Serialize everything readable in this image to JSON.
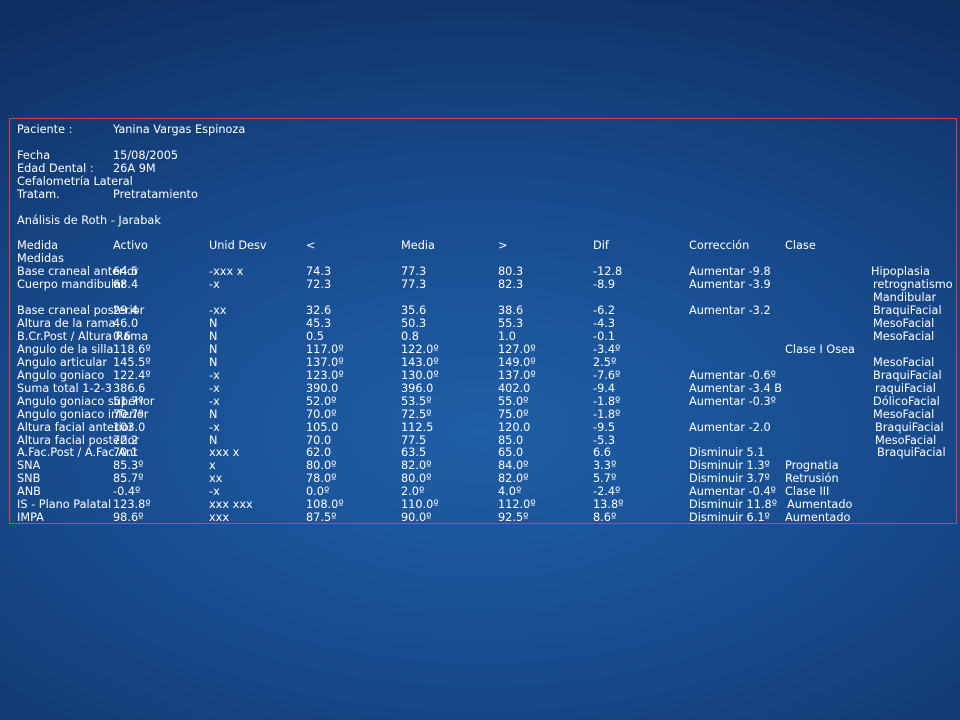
{
  "patient": {
    "patient_label": "Paciente :",
    "patient_value": "Yanina Vargas Espinoza",
    "date_label": "Fecha",
    "date_value": "15/08/2005",
    "age_label": "Edad Dental :",
    "age_value": "26A 9M",
    "study": "Cefalometría Lateral",
    "treatment_label": "Tratam.",
    "treatment_value": "Pretratamiento"
  },
  "analysis_title": "Análisis de Roth - Jarabak",
  "table": {
    "headers": [
      "Medida",
      "Activo",
      "Unid Desv",
      "<",
      "Media",
      ">",
      "Dif",
      "Corrección",
      "Clase"
    ],
    "subheader": "Medidas",
    "rows": [
      [
        "Base craneal anterior",
        "64.5",
        "-xxx x",
        "74.3",
        "77.3",
        "80.3",
        "-12.8",
        "Aumentar -9.8",
        "Hipoplasia"
      ],
      [
        "Cuerpo mandibular",
        "68.4",
        "-x",
        "72.3",
        "77.3",
        "82.3",
        "-8.9",
        "Aumentar -3.9",
        "retrognatismo"
      ],
      [
        "",
        "",
        "",
        "",
        "",
        "",
        "",
        "",
        "Mandibular"
      ],
      [
        "Base craneal posterior",
        "29.4",
        "-xx",
        "32.6",
        "35.6",
        "38.6",
        "-6.2",
        "Aumentar -3.2",
        "BraquiFacial"
      ],
      [
        "Altura de la rama",
        "46.0",
        "N",
        "45.3",
        "50.3",
        "55.3",
        "-4.3",
        "",
        "MesoFacial"
      ],
      [
        "B.Cr.Post / Altura Rama",
        "0.6",
        "N",
        "0.5",
        "0.8",
        "1.0",
        "-0.1",
        "",
        "MesoFacial"
      ],
      [
        "Angulo  de la silla",
        "118.6º",
        "N",
        "117.0º",
        "122.0º",
        "127.0º",
        "-3.4º",
        "",
        "Clase I Osea"
      ],
      [
        "Angulo articular",
        "145.5º",
        "N",
        "137.0º",
        "143.0º",
        "149.0º",
        "2.5º",
        "",
        "MesoFacial"
      ],
      [
        "Angulo goniaco",
        "122.4º",
        "-x",
        "123.0º",
        "130.0º",
        "137.0º",
        "-7.6º",
        "Aumentar -0.6º",
        "BraquiFacial"
      ],
      [
        "Suma total 1-2-3",
        "386.6",
        "-x",
        "390.0",
        "396.0",
        "402.0",
        "-9.4",
        "Aumentar -3.4  B",
        "raquiFacial"
      ],
      [
        "Angulo goniaco superior",
        "51.7º",
        "-x",
        "52.0º",
        "53.5º",
        "55.0º",
        "-1.8º",
        "Aumentar -0.3º",
        "DólicoFacial"
      ],
      [
        "Angulo goniaco inferior",
        "70.7º",
        "N",
        "70.0º",
        "72.5º",
        "75.0º",
        "-1.8º",
        "",
        "MesoFacial"
      ],
      [
        "Altura facial anterior",
        "103.0",
        "-x",
        "105.0",
        "112.5",
        "120.0",
        "-9.5",
        "Aumentar -2.0",
        "BraquiFacial"
      ],
      [
        "Altura facial posterior",
        "72.2",
        "N",
        "70.0",
        "77.5",
        "85.0",
        "-5.3",
        "",
        "MesoFacial"
      ],
      [
        "A.Fac.Post / A.Fac.Ant",
        "70.1",
        "xxx x",
        "62.0",
        "63.5",
        "65.0",
        "6.6",
        "Disminuir 5.1",
        "BraquiFacial"
      ],
      [
        "SNA",
        "85.3º",
        "x",
        "80.0º",
        "82.0º",
        "84.0º",
        "3.3º",
        "Disminuir 1.3º",
        "Prognatia"
      ],
      [
        "SNB",
        "85.7º",
        "xx",
        "78.0º",
        "80.0º",
        "82.0º",
        "5.7º",
        "Disminuir 3.7º",
        "Retrusión"
      ],
      [
        "ANB",
        "-0.4º",
        "-x",
        "0.0º",
        "2.0º",
        "4.0º",
        "-2.4º",
        "Aumentar -0.4º",
        "Clase III"
      ],
      [
        "IS - Plano Palatal",
        "123.8º",
        "xxx xxx",
        "108.0º",
        "110.0º",
        "112.0º",
        "13.8º",
        "Disminuir 11.8º",
        "Aumentado"
      ],
      [
        "IMPA",
        "98.6º",
        "xxx",
        "87.5º",
        "90.0º",
        "92.5º",
        "8.6º",
        "Disminuir 6.1º",
        "Aumentado"
      ]
    ]
  },
  "colors": {
    "frame_border": "#e0403a",
    "text": "#ffffff"
  }
}
